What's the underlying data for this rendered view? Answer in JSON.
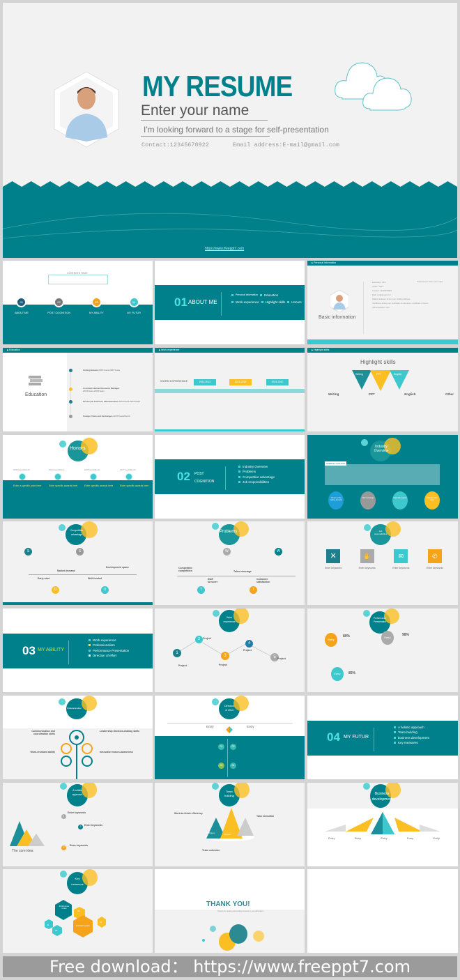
{
  "colors": {
    "teal": "#00808a",
    "cyan": "#3cc8cc",
    "yellow": "#fbbf24",
    "orange": "#f5a31a",
    "gray": "#9e9e9e",
    "bg": "#f2f2f2",
    "banner": "#9b9b9b"
  },
  "cover": {
    "title": "MY RESUME",
    "name": "Enter your name",
    "tagline": "I'm looking forward to a stage for self-presentation",
    "contact": "Contact:12345678922",
    "email": "Email address:E-mail@gmail.com",
    "link": "https://www.freeppt7.com",
    "icons": [
      "avatar-photo",
      "cloud-icon"
    ]
  },
  "contents": {
    "title": "CONTENTS PAGE",
    "items": [
      {
        "num": "01",
        "label": "ABOUT ME"
      },
      {
        "num": "02",
        "label": "POST COGNITION"
      },
      {
        "num": "03",
        "label": "MY ABILITY"
      },
      {
        "num": "04",
        "label": "MY FUTUR"
      }
    ]
  },
  "about": {
    "num": "01",
    "title": "ABOUT ME",
    "items": [
      "Personal information",
      "Education",
      "Work experience",
      "Highlight skills",
      "Honors"
    ]
  },
  "personal": {
    "header": "Personal information",
    "title": "Basic information",
    "fields": [
      "Education: XXX",
      "Professional: Enter your major",
      "Grade: TEXT",
      "Contact: 12345678901",
      "Mail: xxx@gmail.com",
      "Mailing address: Enter your mailing address",
      "Certificate: Enter your certificate of education, certificate of honor",
      "Self-evaluation: text"
    ]
  },
  "education": {
    "header": "Education",
    "title": "Education",
    "entries": [
      {
        "title": "Undergraduate",
        "text": "20XXYears-20XXYears"
      },
      {
        "title": "Assistant Human Resource Manager",
        "text": "20XXYears-20XXYears"
      },
      {
        "title": "On-the-job business administration",
        "text": "20XXYears-20XXYears"
      },
      {
        "title": "Foreign Visits and Exchanges",
        "text": "20XXYears/Month"
      }
    ]
  },
  "work": {
    "header": "Work experience",
    "title": "WORK EXPERIENCE",
    "periods": [
      "2011-2013",
      "2013-2015",
      "2015-2020"
    ]
  },
  "skills": {
    "header": "Highlight skills",
    "title": "Highlight skills",
    "tri": [
      "Writing",
      "PPT",
      "English"
    ],
    "cols": [
      "Writing",
      "PPT",
      "English",
      "Other"
    ]
  },
  "honors": {
    "title": "Honors",
    "dates": [
      "2009Years11Month",
      "2011Years7Month",
      "2018Years6Month",
      "2027Years6Month"
    ],
    "awards": [
      "Enter a specific prize here",
      "Enter specific awards here",
      "Enter specific awards here",
      "Enter specific awards here"
    ]
  },
  "post": {
    "num": "02",
    "title1": "POST",
    "title2": "COGNITION",
    "items": [
      "Industry Overview",
      "Problems",
      "Competitive advantage",
      "Job responsibilities"
    ]
  },
  "industry": {
    "title1": "Industry",
    "title2": "Overview",
    "box_label": "OVERALL OUTLOOK",
    "circles": [
      "There is a big market demand",
      "Talent shortage",
      "Expanding space",
      "Product profit space"
    ]
  },
  "competitive": {
    "title1": "Competitive",
    "title2": "advantage",
    "letters": [
      "S",
      "S",
      "O",
      "O"
    ],
    "labels": [
      "Market demand",
      "Development space",
      "Early start",
      "Well-funded"
    ]
  },
  "problems": {
    "title": "Problems",
    "letters": [
      "W",
      "W",
      "T",
      "T"
    ],
    "labels": [
      "Competitive competition",
      "Talent shortage",
      "Staff turnover",
      "Customer satisfaction"
    ]
  },
  "job": {
    "title1": "Job",
    "title2": "responsibilities",
    "keywords": [
      "Enter keywords",
      "Enter keywords",
      "Enter keywords",
      "Enter keywords"
    ]
  },
  "ability": {
    "num": "03",
    "title": "MY ABILITY",
    "items": [
      "Work experience",
      "Professionalism",
      "Performance Presentation",
      "Direction of effort"
    ]
  },
  "workexp": {
    "title1": "Work",
    "title2": "experience",
    "nums": [
      "1",
      "2",
      "3",
      "4",
      "5"
    ],
    "label": "Project"
  },
  "performance": {
    "title1": "Performance",
    "title2": "Presentation",
    "entries": [
      {
        "label": "Entry",
        "pct": "80%"
      },
      {
        "label": "Entry",
        "pct": "98%"
      },
      {
        "label": "Entry",
        "pct": "85%"
      }
    ]
  },
  "professionalism": {
    "title": "Professionalism",
    "labels": [
      "Communication and coordination skills",
      "Leadership decision-making skills",
      "Work-resistant ability",
      "Innovative macro-awareness"
    ]
  },
  "direction": {
    "title1": "Direction",
    "title2": "of effort",
    "entry": "Entry",
    "nums": [
      "01",
      "02",
      "03",
      "04"
    ]
  },
  "future": {
    "num": "04",
    "title": "MY FUTUR",
    "items": [
      "A holistic approach",
      "Team building",
      "business development",
      "Key measures"
    ]
  },
  "holistic": {
    "title1": "A holistic",
    "title2": "approach",
    "core": "The core idea",
    "keywords": [
      "Enter keywords",
      "Enter keywords",
      "Enter keywords"
    ],
    "nums": [
      "1",
      "2",
      "3"
    ]
  },
  "team": {
    "title1": "Team",
    "title2": "building",
    "labels": [
      "Work-to-finish efficiency",
      "Task execution",
      "Team cohesion"
    ],
    "tri": [
      "Efficiency",
      "Cohesion"
    ]
  },
  "business": {
    "title1": "Business",
    "title2": "development",
    "entries": [
      "Entry",
      "Entry",
      "Entry",
      "Entry",
      "Entry"
    ]
  },
  "keymeasures": {
    "title1": "Key",
    "title2": "measures",
    "hexes": [
      "Performance review",
      "01",
      "Promotion system",
      "02",
      "01",
      "02"
    ]
  },
  "thanks": {
    "title": "THANK YOU!",
    "subtitle": "Thanks for reading and looking forward to your affirmation"
  },
  "banner": {
    "text": "Free download： https://www.freeppt7.com"
  }
}
